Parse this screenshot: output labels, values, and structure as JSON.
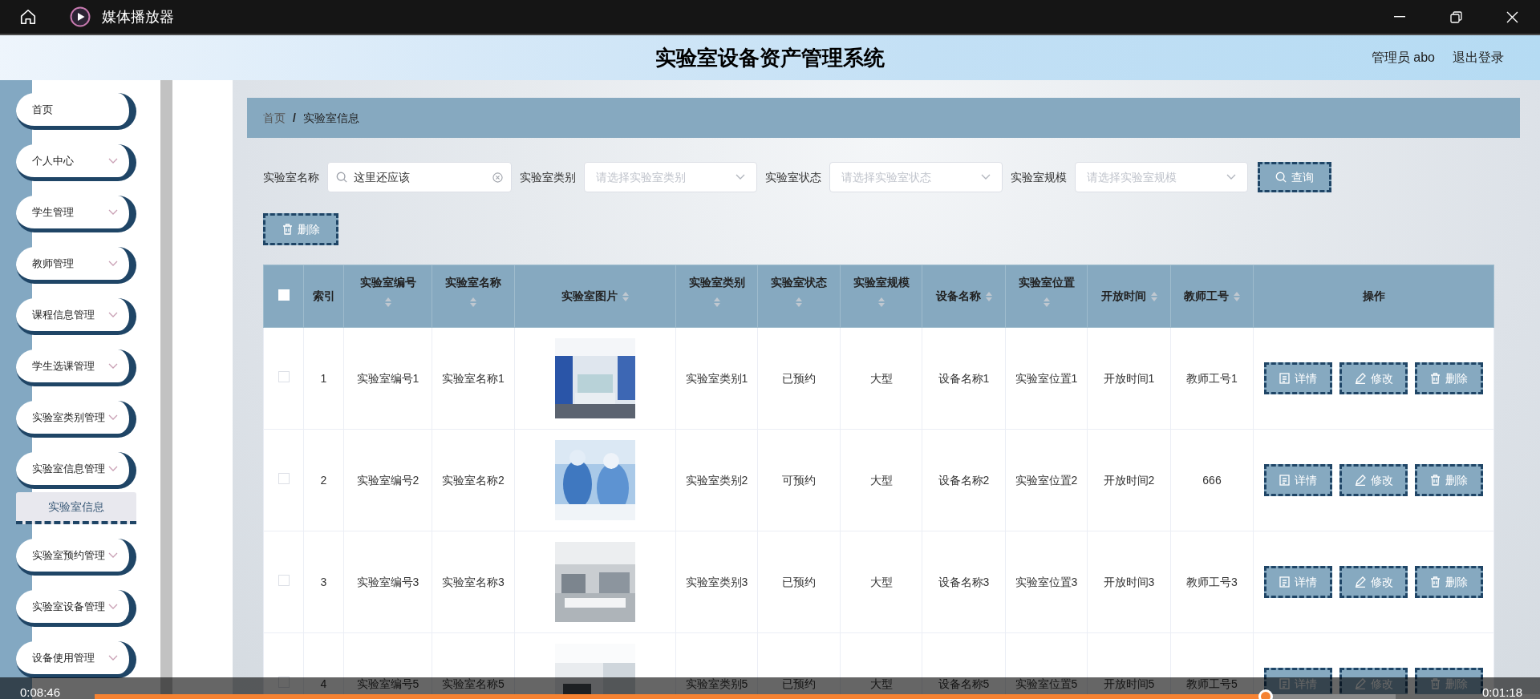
{
  "player": {
    "title": "媒体播放器",
    "elapsed": "0:08:46",
    "remaining": "0:01:18",
    "level": 0.9
  },
  "header": {
    "title": "实验室设备资产管理系统",
    "user": "管理员 abo",
    "logout": "退出登录"
  },
  "sidebar": {
    "items": [
      {
        "label": "首页",
        "kind": "link"
      },
      {
        "label": "个人中心",
        "kind": "menu"
      },
      {
        "label": "学生管理",
        "kind": "menu"
      },
      {
        "label": "教师管理",
        "kind": "menu"
      },
      {
        "label": "课程信息管理",
        "kind": "menu"
      },
      {
        "label": "学生选课管理",
        "kind": "menu"
      },
      {
        "label": "实验室类别管理",
        "kind": "menu"
      },
      {
        "label": "实验室信息管理",
        "kind": "menu",
        "children": [
          {
            "label": "实验室信息",
            "selected": true
          }
        ]
      },
      {
        "label": "实验室预约管理",
        "kind": "menu"
      },
      {
        "label": "实验室设备管理",
        "kind": "menu"
      },
      {
        "label": "设备使用管理",
        "kind": "menu"
      }
    ]
  },
  "breadcrumb": [
    {
      "label": "首页",
      "kind": "link"
    },
    {
      "label": "/",
      "kind": "separator"
    },
    {
      "label": "实验室信息",
      "kind": "current"
    }
  ],
  "filters": [
    {
      "label": "实验室名称",
      "kind": "search",
      "value": "这里还应该"
    },
    {
      "label": "实验室类别",
      "kind": "select",
      "placeholder": "请选择实验室类别"
    },
    {
      "label": "实验室状态",
      "kind": "select",
      "placeholder": "请选择实验室状态"
    },
    {
      "label": "实验室规模",
      "kind": "select",
      "placeholder": "请选择实验室规模"
    }
  ],
  "query_button": "查询",
  "delete_button": "删除",
  "table": {
    "select_all_checked": false,
    "columns": [
      {
        "label": "索引",
        "kind": "plain"
      },
      {
        "label": "实验室编号",
        "kind": "sort_below"
      },
      {
        "label": "实验室名称",
        "kind": "sort_below"
      },
      {
        "label": "实验室图片",
        "kind": "sort_inline"
      },
      {
        "label": "实验室类别",
        "kind": "sort_below"
      },
      {
        "label": "实验室状态",
        "kind": "sort_below"
      },
      {
        "label": "实验室规模",
        "kind": "sort_below"
      },
      {
        "label": "设备名称",
        "kind": "sort_inline"
      },
      {
        "label": "实验室位置",
        "kind": "sort_below"
      },
      {
        "label": "开放时间",
        "kind": "sort_inline"
      },
      {
        "label": "教师工号",
        "kind": "sort_inline"
      },
      {
        "label": "操作",
        "kind": "plain"
      }
    ],
    "rows": [
      {
        "checked": false,
        "cells": [
          "1",
          "实验室编号1",
          "实验室名称1",
          {
            "kind": "picture"
          },
          "实验室类别1",
          "已预约",
          "大型",
          "设备名称1",
          "实验室位置1",
          "开放时间1",
          "教师工号1"
        ],
        "actions": [
          {
            "label": "详情",
            "kind": "detail"
          },
          {
            "label": "修改",
            "kind": "edit"
          },
          {
            "label": "删除",
            "kind": "delete"
          }
        ]
      },
      {
        "checked": false,
        "cells": [
          "2",
          "实验室编号2",
          "实验室名称2",
          {
            "kind": "picture"
          },
          "实验室类别2",
          "可预约",
          "大型",
          "设备名称2",
          "实验室位置2",
          "开放时间2",
          "666"
        ],
        "actions": [
          {
            "label": "详情",
            "kind": "detail"
          },
          {
            "label": "修改",
            "kind": "edit"
          },
          {
            "label": "删除",
            "kind": "delete"
          }
        ]
      },
      {
        "checked": false,
        "cells": [
          "3",
          "实验室编号3",
          "实验室名称3",
          {
            "kind": "picture"
          },
          "实验室类别3",
          "已预约",
          "大型",
          "设备名称3",
          "实验室位置3",
          "开放时间3",
          "教师工号3"
        ],
        "actions": [
          {
            "label": "详情",
            "kind": "detail"
          },
          {
            "label": "修改",
            "kind": "edit"
          },
          {
            "label": "删除",
            "kind": "delete"
          }
        ]
      },
      {
        "checked": false,
        "cells": [
          "4",
          "实验室编号5",
          "实验室名称5",
          {
            "kind": "picture"
          },
          "实验室类别5",
          "已预约",
          "大型",
          "设备名称5",
          "实验室位置5",
          "开放时间5",
          "教师工号5"
        ],
        "actions": [
          {
            "label": "详情",
            "kind": "detail"
          },
          {
            "label": "修改",
            "kind": "edit"
          },
          {
            "label": "删除",
            "kind": "delete"
          }
        ]
      }
    ]
  }
}
